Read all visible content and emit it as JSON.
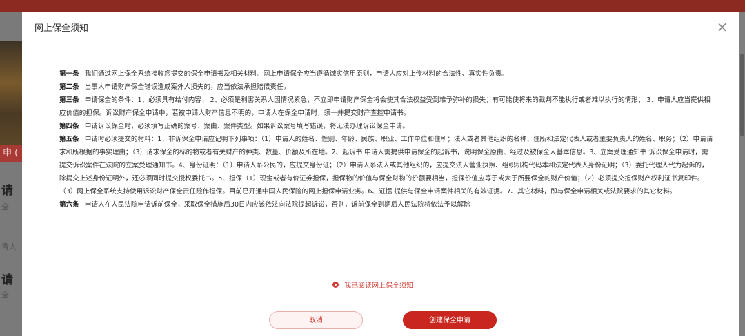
{
  "background": {
    "banner_text": "",
    "tab_text": "申 (",
    "left_texts": [
      "请",
      "全",
      "青人",
      "请",
      "全"
    ]
  },
  "modal": {
    "title": "网上保全须知",
    "close_icon": "close-icon",
    "articles": [
      {
        "label": "第一条",
        "text": "我们通过网上保全系统接收您提交的保全申请书及相关材料。网上申请保全应当遵循诚实信用原则，申请人应对上传材料的合法性、真实性负责。"
      },
      {
        "label": "第二条",
        "text": "当事人申请财产保全错误造成案外人损失的，应当依法承担赔偿责任。"
      },
      {
        "label": "第三条",
        "text": "申请保全的条件：1、必须具有给付内容； 2、必须是利害关系人因情况紧急，不立即申请财产保全将会使其合法权益受到难予弥补的损失；有可能使将来的裁判不能执行或者难以执行的情形； 3、申请人应当提供相应价值的担保。诉讼财产保全申请中，若被申请人财产信息不明的，申请人在保全申请时，须一并提交财产查控申请书。"
      },
      {
        "label": "第四条",
        "text": "申请诉讼保全时，必须填写正确的案号、案由、案件类型。如果诉讼案号填写错误，将无法办理诉讼保全申请。"
      },
      {
        "label": "第五条",
        "text": "申请时必须提交的材料：1、非诉保全申请应记明下列事项：（1）申请人的姓名、性别、年龄、民族、职业、工作单位和住所；法人或者其他组织的名称、住所和法定代表人或者主要负责人的姓名、职务；（2）申请请求和所根据的事实理由；（3）请求保全的标的物或者有关财产的种类、数量、价额及所在地。2、起诉书 申请人需提供申请保全的起诉书，说明保全原由、经过及被保全人基本信息。3、立案受理通知书 诉讼保全申请时，需提交诉讼案件在法院的立案受理通知书。4、身份证明：（1）申请人系公民的，应提交身份证；（2）申请人系法人或其他组织的，应提交法人营业执照、组织机构代码本和法定代表人身份证明；（3）委托代理人代为起诉的，除提交上述身份证明外，还必须同时提交授权委托书。5、担保（1）现金或者有价证券担保，担保物的价值与保全财物的价额要相当，担保价值应等于或大于所要保全的财产价值；（2）必须提交担保财产权利证书复印件。（3）网上保全系统支持使用诉讼财产保全责任险作担保。目前已开通中国人民保险的网上担保申请业务。6、证据 提供与保全申请案件相关的有效证据。7、其它材料，即与保全申请相关或法院要求的其它材料。"
      },
      {
        "label": "第六条",
        "text": "申请人在人民法院申请诉前保全，采取保全措施后30日内应该依法向法院提起诉讼，否则，诉前保全到期后人民法院将依法予以解除"
      }
    ],
    "agree_label": "我已阅读网上保全须知",
    "cancel_label": "取消",
    "create_label": "创建保全申请"
  },
  "colors": {
    "accent": "#c8261e",
    "banner": "#8c2a22"
  }
}
